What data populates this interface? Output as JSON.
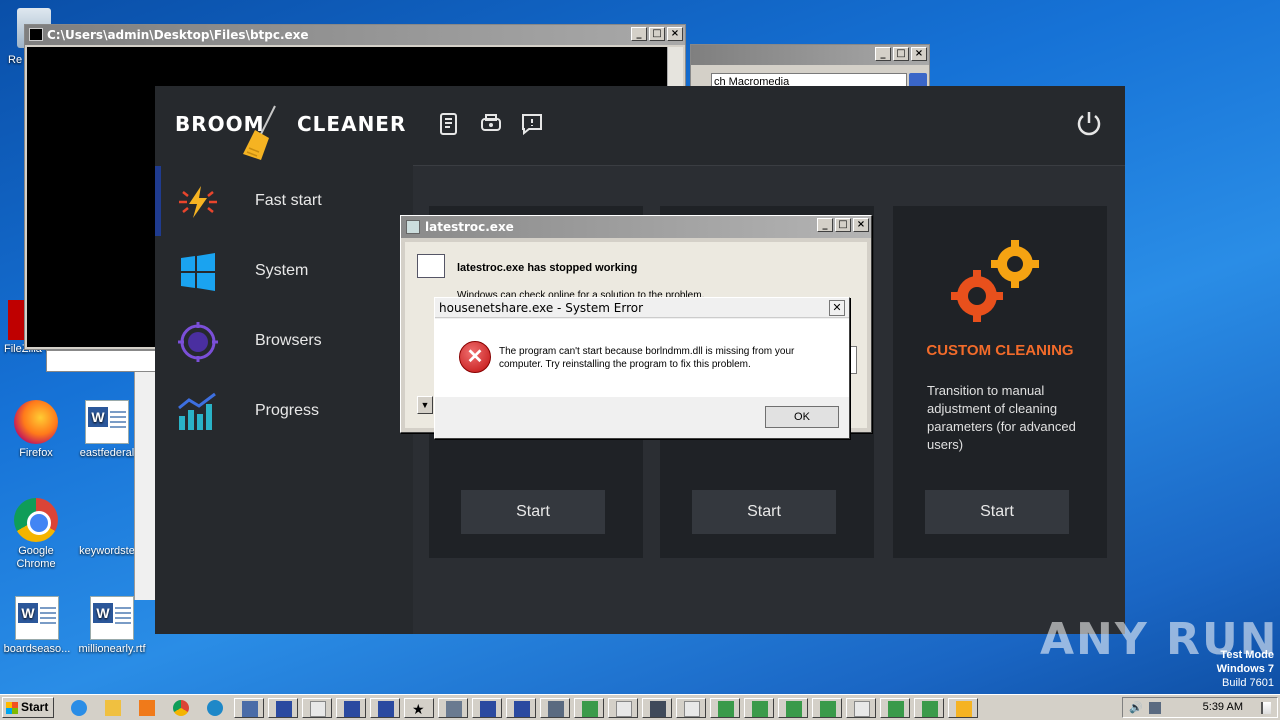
{
  "desktop": {
    "icons": [
      {
        "label": "Re",
        "icon": "recycle-bin-icon"
      },
      {
        "label": "FileZilla C",
        "icon": "filezilla-icon"
      },
      {
        "label": "Firefox",
        "icon": "firefox-icon"
      },
      {
        "label": "eastfederal",
        "icon": "word-doc-icon"
      },
      {
        "label": "Google Chrome",
        "icon": "chrome-icon"
      },
      {
        "label": "keywordste",
        "icon": "file-icon"
      },
      {
        "label": "boardseaso...",
        "icon": "word-doc-icon"
      },
      {
        "label": "millionearly.rtf",
        "icon": "word-doc-icon"
      }
    ]
  },
  "console": {
    "title": "C:\\Users\\admin\\Desktop\\Files\\btpc.exe"
  },
  "explorer": {
    "address": "ch Macromedia"
  },
  "app": {
    "logo_left": "BROOM",
    "logo_right": "CLEANER",
    "nav": [
      {
        "label": "Fast start",
        "icon": "lightning-icon"
      },
      {
        "label": "System",
        "icon": "windows-icon"
      },
      {
        "label": "Browsers",
        "icon": "browser-target-icon"
      },
      {
        "label": "Progress",
        "icon": "bar-chart-icon"
      }
    ],
    "header_icons": [
      "report-icon",
      "printer-icon",
      "feedback-icon",
      "power-icon"
    ],
    "cards": [
      {
        "title": "",
        "desc": "",
        "button": "Start"
      },
      {
        "title": "",
        "desc": "",
        "button": "Start"
      },
      {
        "title": "CUSTOM CLEANING",
        "desc": "Transition to manual adjustment of cleaning parameters (for advanced users)",
        "button": "Start"
      }
    ]
  },
  "dialog_latestroc": {
    "title": "latestroc.exe",
    "heading": "latestroc.exe has stopped working",
    "sub": "Windows can check online for a solution to the problem."
  },
  "dialog_error": {
    "title": "housenetshare.exe - System Error",
    "message": "The program can't start because borlndmm.dll is missing from your computer. Try reinstalling the program to fix this problem.",
    "ok": "OK"
  },
  "watermark": "ANY RUN",
  "testmode": {
    "line1": "Test Mode",
    "line2": "Windows 7",
    "line3": "Build 7601"
  },
  "taskbar": {
    "start": "Start",
    "clock": "5:39 AM"
  }
}
